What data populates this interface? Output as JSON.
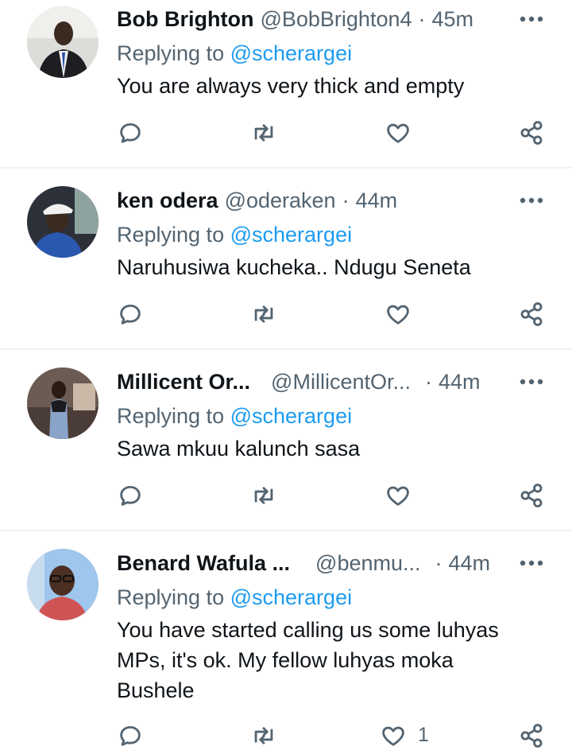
{
  "replying_prefix": "Replying to",
  "tweets": [
    {
      "name": "Bob Brighton",
      "handle": "@BobBrighton4",
      "time": "45m",
      "reply_to": "@scherargei",
      "text": "You are always very thick and empty",
      "avatar_icon": "person-in-suit-avatar",
      "like_count": ""
    },
    {
      "name": "ken odera",
      "handle": "@oderaken",
      "time": "44m",
      "reply_to": "@scherargei",
      "text": "Naruhusiwa kucheka.. Ndugu  Seneta",
      "avatar_icon": "man-with-cap-avatar",
      "like_count": ""
    },
    {
      "name": "Millicent Or...",
      "handle": "@MillicentOr...",
      "time": "44m",
      "reply_to": "@scherargei",
      "text": "Sawa mkuu kalunch sasa",
      "avatar_icon": "woman-in-restaurant-avatar",
      "like_count": ""
    },
    {
      "name": "Benard Wafula ...",
      "handle": "@benmu...",
      "time": "44m",
      "reply_to": "@scherargei",
      "text": "You have started calling us some luhyas MPs, it's ok. My fellow luhyas moka Bushele",
      "avatar_icon": "man-with-glasses-avatar",
      "like_count": "1"
    }
  ],
  "colors": {
    "text": "#0f1419",
    "secondary": "#536471",
    "mention": "#1d9bf0",
    "divider": "#eff3f4"
  }
}
